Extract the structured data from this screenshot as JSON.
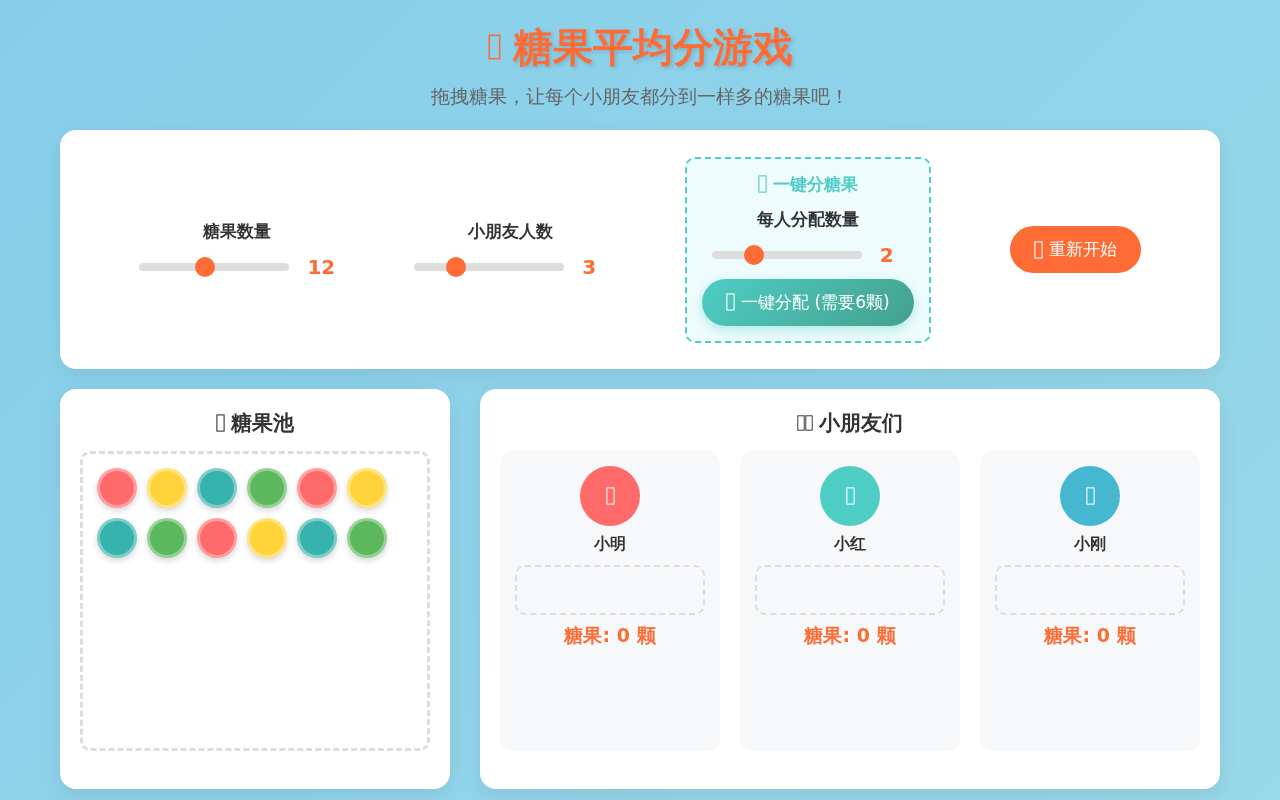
{
  "header": {
    "title": "糖果平均分游戏",
    "subtitle": "拖拽糖果，让每个小朋友都分到一样多的糖果吧！"
  },
  "controls": {
    "sliders": [
      {
        "label": "糖果数量",
        "level": 0.44,
        "reading": "12"
      },
      {
        "label": "小朋友人数",
        "level": 0.28,
        "reading": "3"
      }
    ],
    "quick_split": {
      "title": "一键分糖果",
      "label": "每人分配数量",
      "level": 0.28,
      "reading": "2",
      "button": "一键分配 (需要6颗)"
    },
    "reset_button": "重新开始"
  },
  "pool": {
    "title": "糖果池",
    "candies": [
      {
        "color": "#ff6b6b"
      },
      {
        "color": "#ffd43b"
      },
      {
        "color": "#38b2ac"
      },
      {
        "color": "#5cb85c"
      },
      {
        "color": "#ff6b6b"
      },
      {
        "color": "#ffd43b"
      },
      {
        "color": "#38b2ac"
      },
      {
        "color": "#5cb85c"
      },
      {
        "color": "#ff6b6b"
      },
      {
        "color": "#ffd43b"
      },
      {
        "color": "#38b2ac"
      },
      {
        "color": "#5cb85c"
      }
    ]
  },
  "children": {
    "title": "小朋友们",
    "kids": [
      {
        "name": "小明",
        "color": "#ff6b6b",
        "count": "糖果: 0 颗"
      },
      {
        "name": "小红",
        "color": "#4ecdc4",
        "count": "糖果: 0 颗"
      },
      {
        "name": "小刚",
        "color": "#45b7d1",
        "count": "糖果: 0 颗"
      }
    ]
  }
}
